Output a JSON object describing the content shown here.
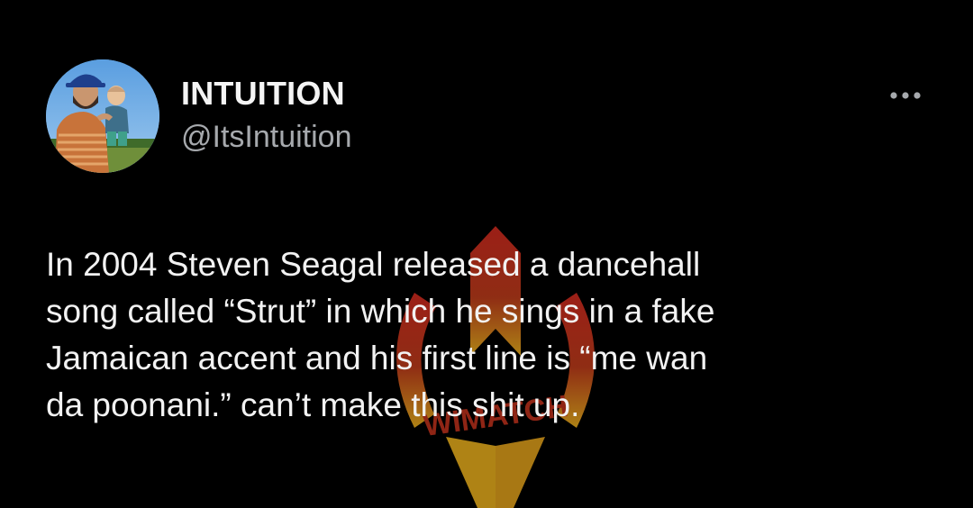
{
  "tweet": {
    "author": {
      "display_name": "INTUITION",
      "handle": "@ItsIntuition"
    },
    "more_icon": "more-horizontal-icon",
    "text": "In 2004 Steven Seagal released a dancehall\nsong called “Strut” in which he sings in a fake\nJamaican accent and his first line is “me wan\nda poonani.” can’t make this shit up."
  },
  "watermark": {
    "text": "WIMATCH",
    "colors": [
      "#c8281e",
      "#e0a81c"
    ]
  },
  "colors": {
    "background": "#000000",
    "primary_text": "#f2f2f2",
    "secondary_text": "#a6a9ad"
  }
}
